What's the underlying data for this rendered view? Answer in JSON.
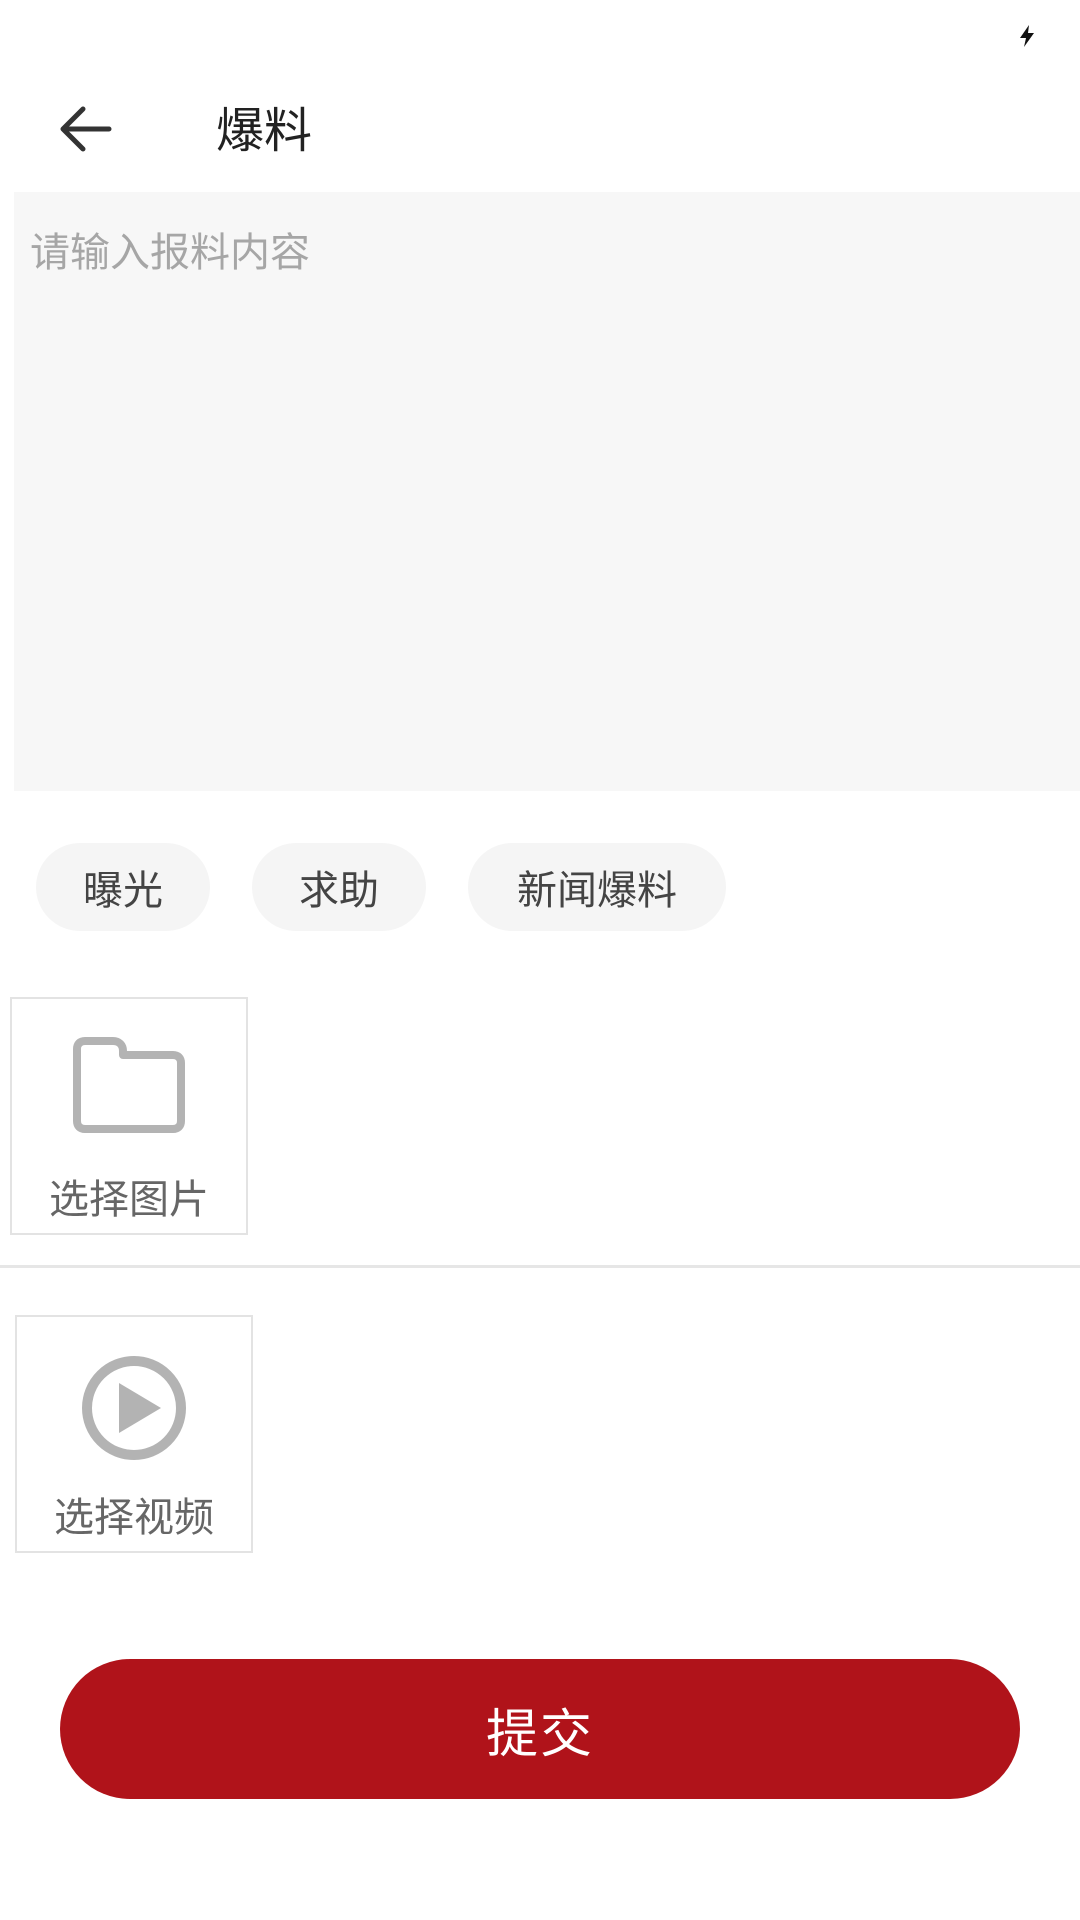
{
  "status_bar": {
    "charging_icon": "lightning-bolt-icon"
  },
  "toolbar": {
    "back_icon": "arrow-left-icon",
    "title": "爆料"
  },
  "content": {
    "value": "",
    "placeholder": "请输入报料内容"
  },
  "categories": [
    {
      "label": "曝光"
    },
    {
      "label": "求助"
    },
    {
      "label": "新闻爆料"
    }
  ],
  "media": {
    "image_picker": {
      "icon": "folder-icon",
      "label": "选择图片"
    },
    "video_picker": {
      "icon": "play-circle-icon",
      "label": "选择视频"
    }
  },
  "submit": {
    "label": "提交"
  },
  "colors": {
    "accent": "#b0131a",
    "input_background": "#f7f7f7",
    "chip_background": "#f5f5f5",
    "icon_gray": "#b3b3b3"
  }
}
